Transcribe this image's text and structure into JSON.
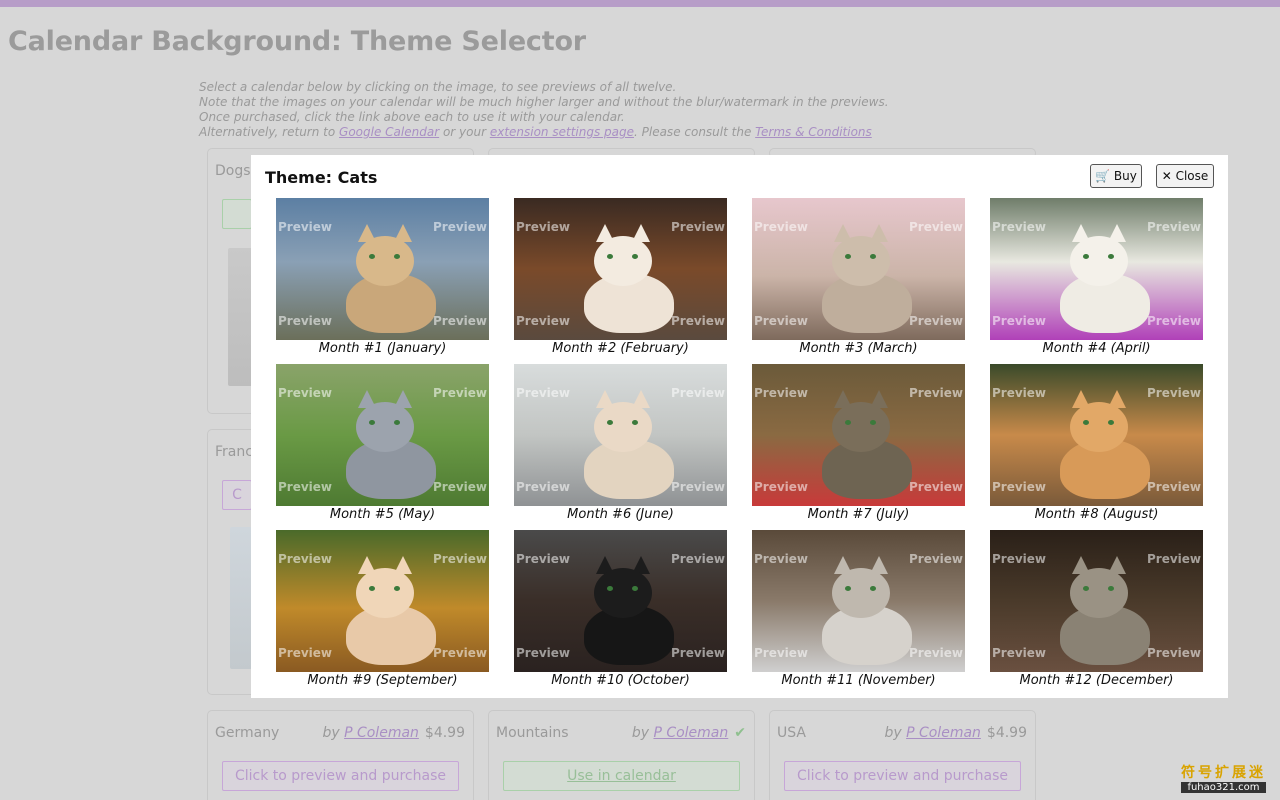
{
  "page": {
    "title": "Calendar Background: Theme Selector",
    "intro_line1": "Select a calendar below by clicking on the image, to see previews of all twelve.",
    "intro_line2": "Note that the images on your calendar will be much higher larger and without the blur/watermark in the previews.",
    "intro_line3": "Once purchased, click the link above each to use it with your calendar.",
    "intro_line4_a": "Alternatively, return to ",
    "intro_link_calendar": "Google Calendar",
    "intro_line4_b": " or your ",
    "intro_link_settings": "extension settings page",
    "intro_line4_c": ". Please consult the ",
    "intro_link_terms": "Terms & Conditions"
  },
  "cards": {
    "dogs": {
      "name": "Dogs"
    },
    "france": {
      "name": "France",
      "button": "C"
    },
    "germany": {
      "name": "Germany",
      "by": "by ",
      "author": "P Coleman",
      "price": "$4.99",
      "button": "Click to preview and purchase"
    },
    "mountains": {
      "name": "Mountains",
      "by": "by ",
      "author": "P Coleman",
      "check": "✔",
      "button": "Use in calendar"
    },
    "usa": {
      "name": "USA",
      "by": "by ",
      "author": "P Coleman",
      "price": "$4.99",
      "button": "Click to preview and purchase"
    }
  },
  "modal": {
    "title": "Theme: Cats",
    "buy_label": "🛒 Buy",
    "close_label": "✕ Close",
    "watermark": "Preview",
    "months": [
      "Month #1 (January)",
      "Month #2 (February)",
      "Month #3 (March)",
      "Month #4 (April)",
      "Month #5 (May)",
      "Month #6 (June)",
      "Month #7 (July)",
      "Month #8 (August)",
      "Month #9 (September)",
      "Month #10 (October)",
      "Month #11 (November)",
      "Month #12 (December)"
    ]
  },
  "site_watermark": {
    "cn": "符号扩展迷",
    "en": "fuhao321.com"
  },
  "colors": {
    "accent": "#b79dc8",
    "overlay": "#d7d7d7",
    "link": "#a98fc4",
    "green": "#a9d0a9"
  }
}
